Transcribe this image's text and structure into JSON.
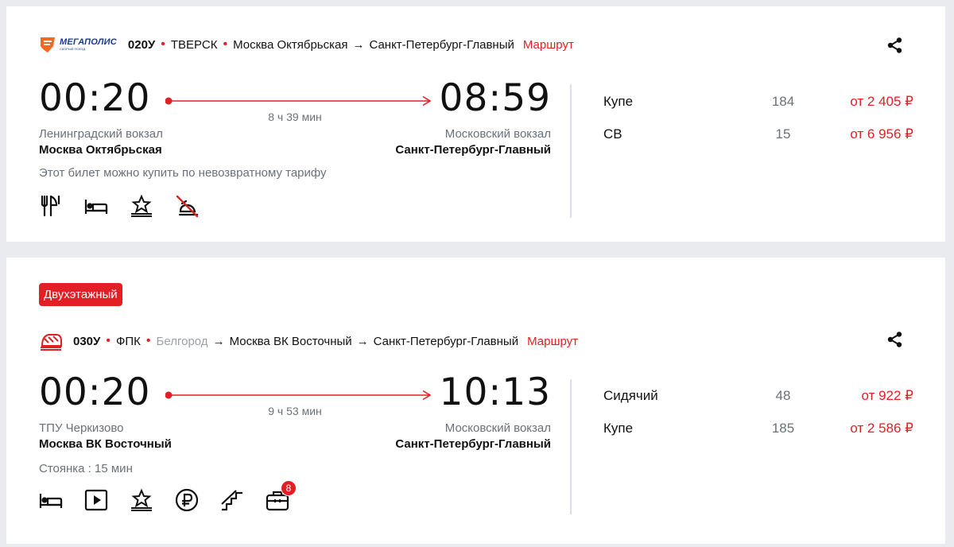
{
  "colors": {
    "accent": "#e31e24",
    "muted": "#6b7179",
    "divider": "#dcdfe3"
  },
  "trains": [
    {
      "brand_logo_text": "МЕГАПОЛИС",
      "brand_logo_sub": "СКОРЫЙ ПОЕЗД",
      "number": "020У",
      "carrier": "ТВЕРСК",
      "route_from": "Москва Октябрьская",
      "route_to": "Санкт-Петербург-Главный",
      "route_link": "Маршрут",
      "dep_time": "00:20",
      "arr_time": "08:59",
      "duration": "8 ч 39 мин",
      "dep_station_sub": "Ленинградский вокзал",
      "dep_station": "Москва Октябрьская",
      "arr_station_sub": "Московский вокзал",
      "arr_station": "Санкт-Петербург-Главный",
      "note": "Этот билет можно купить по невозвратному тарифу",
      "amenities": [
        "restaurant-icon",
        "bed-icon",
        "premium-icon",
        "no-pets-icon"
      ],
      "fares": [
        {
          "class": "Купе",
          "seats": "184",
          "price": "от 2 405 ₽"
        },
        {
          "class": "СВ",
          "seats": "15",
          "price": "от 6 956 ₽"
        }
      ]
    },
    {
      "tag": "Двухэтажный",
      "number": "030У",
      "carrier": "ФПК",
      "route_origin": "Белгород",
      "route_from": "Москва ВК Восточный",
      "route_to": "Санкт-Петербург-Главный",
      "route_link": "Маршрут",
      "dep_time": "00:20",
      "arr_time": "10:13",
      "duration": "9 ч 53 мин",
      "dep_station_sub": "ТПУ Черкизово",
      "dep_station": "Москва ВК Восточный",
      "arr_station_sub": "Московский вокзал",
      "arr_station": "Санкт-Петербург-Главный",
      "note": "Стоянка : 15 мин",
      "amenities": [
        "bed-icon",
        "video-icon",
        "premium-icon",
        "ruble-icon",
        "stairs-icon",
        "luggage-icon"
      ],
      "luggage_count": "8",
      "fares": [
        {
          "class": "Сидячий",
          "seats": "48",
          "price": "от 922 ₽"
        },
        {
          "class": "Купе",
          "seats": "185",
          "price": "от 2 586 ₽"
        }
      ]
    }
  ]
}
